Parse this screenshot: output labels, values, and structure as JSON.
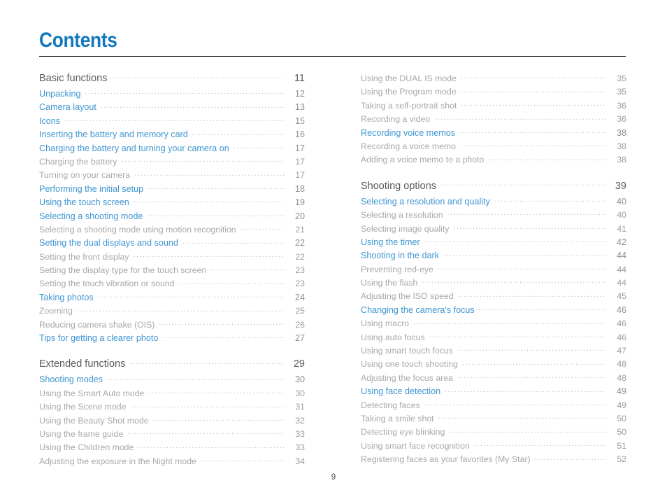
{
  "document": {
    "title": "Contents",
    "footer_page_number": "9",
    "accent_color": "#1478be",
    "link_color": "#3f96d2",
    "section_color": "#595959",
    "sub_color": "#a8a8a8",
    "rule_color": "#1a1a1a"
  },
  "columns": {
    "left": [
      {
        "label": "Basic functions",
        "page": "11",
        "level": "section",
        "gap": false
      },
      {
        "label": "Unpacking",
        "page": "12",
        "level": "link",
        "gap": false
      },
      {
        "label": "Camera layout",
        "page": "13",
        "level": "link",
        "gap": false
      },
      {
        "label": "Icons",
        "page": "15",
        "level": "link",
        "gap": false
      },
      {
        "label": "Inserting the battery and memory card",
        "page": "16",
        "level": "link",
        "gap": false
      },
      {
        "label": "Charging the battery and turning your camera on",
        "page": "17",
        "level": "link",
        "gap": false
      },
      {
        "label": "Charging the battery",
        "page": "17",
        "level": "sub",
        "gap": false
      },
      {
        "label": "Turning on your camera",
        "page": "17",
        "level": "sub",
        "gap": false
      },
      {
        "label": "Performing the initial setup",
        "page": "18",
        "level": "link",
        "gap": false
      },
      {
        "label": "Using the touch screen",
        "page": "19",
        "level": "link",
        "gap": false
      },
      {
        "label": "Selecting a shooting mode",
        "page": "20",
        "level": "link",
        "gap": false
      },
      {
        "label": "Selecting a shooting mode using motion recognition",
        "page": "21",
        "level": "sub",
        "gap": false
      },
      {
        "label": "Setting the dual displays and sound",
        "page": "22",
        "level": "link",
        "gap": false
      },
      {
        "label": "Setting the front display",
        "page": "22",
        "level": "sub",
        "gap": false
      },
      {
        "label": "Setting the display type for the touch screen",
        "page": "23",
        "level": "sub",
        "gap": false
      },
      {
        "label": "Setting the touch vibration or sound",
        "page": "23",
        "level": "sub",
        "gap": false
      },
      {
        "label": "Taking photos",
        "page": "24",
        "level": "link",
        "gap": false
      },
      {
        "label": "Zooming",
        "page": "25",
        "level": "sub",
        "gap": false
      },
      {
        "label": "Reducing camera shake (OIS)",
        "page": "26",
        "level": "sub",
        "gap": false
      },
      {
        "label": "Tips for getting a clearer photo",
        "page": "27",
        "level": "link",
        "gap": false
      },
      {
        "label": "Extended functions",
        "page": "29",
        "level": "section",
        "gap": true
      },
      {
        "label": "Shooting modes",
        "page": "30",
        "level": "link",
        "gap": false
      },
      {
        "label": "Using the Smart Auto mode",
        "page": "30",
        "level": "sub",
        "gap": false
      },
      {
        "label": "Using the Scene mode",
        "page": "31",
        "level": "sub",
        "gap": false
      },
      {
        "label": "Using the Beauty Shot mode",
        "page": "32",
        "level": "sub",
        "gap": false
      },
      {
        "label": "Using the frame guide",
        "page": "33",
        "level": "sub",
        "gap": false
      },
      {
        "label": "Using the Children mode",
        "page": "33",
        "level": "sub",
        "gap": false
      },
      {
        "label": "Adjusting the exposure in the Night mode",
        "page": "34",
        "level": "sub",
        "gap": false
      }
    ],
    "right": [
      {
        "label": "Using the DUAL IS mode",
        "page": "35",
        "level": "sub",
        "gap": false
      },
      {
        "label": "Using the Program mode",
        "page": "35",
        "level": "sub",
        "gap": false
      },
      {
        "label": "Taking a self-portrait shot",
        "page": "36",
        "level": "sub",
        "gap": false
      },
      {
        "label": "Recording a video",
        "page": "36",
        "level": "sub",
        "gap": false
      },
      {
        "label": "Recording voice memos",
        "page": "38",
        "level": "link",
        "gap": false
      },
      {
        "label": "Recording a voice memo",
        "page": "38",
        "level": "sub",
        "gap": false
      },
      {
        "label": "Adding a voice memo to a photo",
        "page": "38",
        "level": "sub",
        "gap": false
      },
      {
        "label": "Shooting options",
        "page": "39",
        "level": "section",
        "gap": true
      },
      {
        "label": "Selecting a resolution and quality",
        "page": "40",
        "level": "link",
        "gap": false
      },
      {
        "label": "Selecting a resolution",
        "page": "40",
        "level": "sub",
        "gap": false
      },
      {
        "label": "Selecting image quality",
        "page": "41",
        "level": "sub",
        "gap": false
      },
      {
        "label": "Using the timer",
        "page": "42",
        "level": "link",
        "gap": false
      },
      {
        "label": "Shooting in the dark",
        "page": "44",
        "level": "link",
        "gap": false
      },
      {
        "label": "Preventing red-eye",
        "page": "44",
        "level": "sub",
        "gap": false
      },
      {
        "label": "Using the flash",
        "page": "44",
        "level": "sub",
        "gap": false
      },
      {
        "label": "Adjusting the ISO speed",
        "page": "45",
        "level": "sub",
        "gap": false
      },
      {
        "label": "Changing the camera's focus",
        "page": "46",
        "level": "link",
        "gap": false
      },
      {
        "label": "Using macro",
        "page": "46",
        "level": "sub",
        "gap": false
      },
      {
        "label": "Using auto focus",
        "page": "46",
        "level": "sub",
        "gap": false
      },
      {
        "label": "Using smart touch focus",
        "page": "47",
        "level": "sub",
        "gap": false
      },
      {
        "label": "Using one touch shooting",
        "page": "48",
        "level": "sub",
        "gap": false
      },
      {
        "label": "Adjusting the focus area",
        "page": "48",
        "level": "sub",
        "gap": false
      },
      {
        "label": "Using face detection",
        "page": "49",
        "level": "link",
        "gap": false
      },
      {
        "label": "Detecting faces",
        "page": "49",
        "level": "sub",
        "gap": false
      },
      {
        "label": "Taking a smile shot",
        "page": "50",
        "level": "sub",
        "gap": false
      },
      {
        "label": "Detecting eye blinking",
        "page": "50",
        "level": "sub",
        "gap": false
      },
      {
        "label": "Using smart face recognition",
        "page": "51",
        "level": "sub",
        "gap": false
      },
      {
        "label": "Registering faces as your favorites (My Star)",
        "page": "52",
        "level": "sub",
        "gap": false
      }
    ]
  }
}
